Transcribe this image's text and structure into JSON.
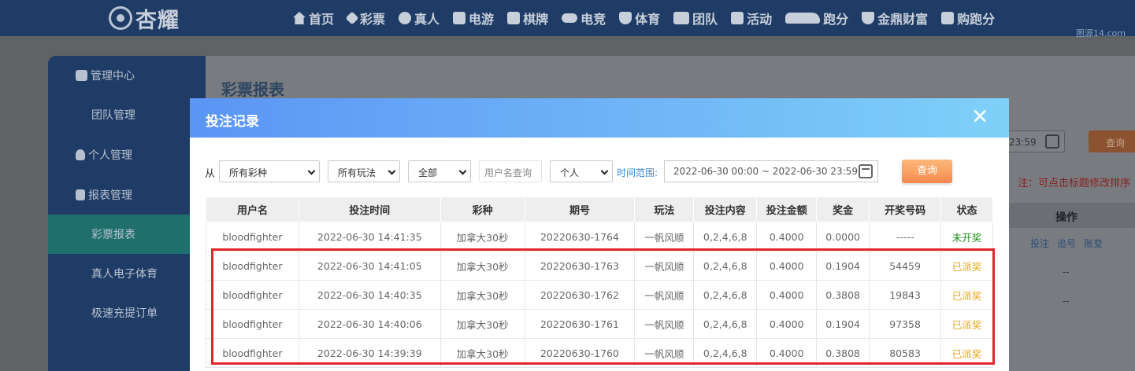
{
  "nav": {
    "logo_text": "杏耀",
    "items": [
      {
        "label": "首页",
        "icon": "home-icon"
      },
      {
        "label": "彩票",
        "icon": "diamond-icon"
      },
      {
        "label": "真人",
        "icon": "person-icon"
      },
      {
        "label": "电游",
        "icon": "game-icon"
      },
      {
        "label": "棋牌",
        "icon": "cards-icon"
      },
      {
        "label": "电竞",
        "icon": "gamepad-icon"
      },
      {
        "label": "体育",
        "icon": "trophy-icon"
      },
      {
        "label": "团队",
        "icon": "team-icon"
      },
      {
        "label": "活动",
        "icon": "gift-icon"
      },
      {
        "label": "跑分",
        "icon": "car-icon"
      },
      {
        "label": "金鼎财富",
        "icon": "money-icon"
      },
      {
        "label": "购跑分",
        "icon": "hi-icon"
      }
    ],
    "watermark": "图源14.com"
  },
  "sidebar": {
    "items": [
      {
        "label": "管理中心",
        "type": "group",
        "icon": "users-icon"
      },
      {
        "label": "团队管理",
        "type": "sub"
      },
      {
        "label": "个人管理",
        "type": "group",
        "icon": "user-icon"
      },
      {
        "label": "报表管理",
        "type": "group",
        "icon": "report-icon"
      },
      {
        "label": "彩票报表",
        "type": "sub",
        "active": true
      },
      {
        "label": "真人电子体育",
        "type": "sub"
      },
      {
        "label": "极速充提订单",
        "type": "sub"
      }
    ]
  },
  "background": {
    "page_title": "彩票报表",
    "date_partial": "23:59",
    "query_label": "查询",
    "note": "注：可点击标题修改排序",
    "op_header": "操作",
    "links": [
      "投注",
      "追号",
      "账变"
    ],
    "dash": "--"
  },
  "modal": {
    "title": "投注记录",
    "close_symbol": "✕",
    "filters": {
      "from_label": "从",
      "lottery": "所有彩种",
      "play": "所有玩法",
      "scope": "全部",
      "username_placeholder": "用户名查询",
      "person": "个人",
      "range_label": "时间范围:",
      "range_value": "2022-06-30 00:00 ~ 2022-06-30 23:59",
      "query_label": "查询"
    },
    "headers": [
      "用户名",
      "投注时间",
      "彩种",
      "期号",
      "玩法",
      "投注内容",
      "投注金额",
      "奖金",
      "开奖号码",
      "状态"
    ],
    "rows": [
      {
        "user": "bloodfighter",
        "time": "2022-06-30 14:41:35",
        "lottery": "加拿大30秒",
        "period": "20220630-1764",
        "play": "一帆风顺",
        "content": "0,2,4,6,8",
        "amount": "0.4000",
        "prize": "0.0000",
        "number": "-----",
        "status": "未开奖",
        "status_type": "open"
      },
      {
        "user": "bloodfighter",
        "time": "2022-06-30 14:41:05",
        "lottery": "加拿大30秒",
        "period": "20220630-1763",
        "play": "一帆风顺",
        "content": "0,2,4,6,8",
        "amount": "0.4000",
        "prize": "0.1904",
        "number": "54459",
        "status": "已派奖",
        "status_type": "paid"
      },
      {
        "user": "bloodfighter",
        "time": "2022-06-30 14:40:35",
        "lottery": "加拿大30秒",
        "period": "20220630-1762",
        "play": "一帆风顺",
        "content": "0,2,4,6,8",
        "amount": "0.4000",
        "prize": "0.3808",
        "number": "19843",
        "status": "已派奖",
        "status_type": "paid"
      },
      {
        "user": "bloodfighter",
        "time": "2022-06-30 14:40:06",
        "lottery": "加拿大30秒",
        "period": "20220630-1761",
        "play": "一帆风顺",
        "content": "0,2,4,6,8",
        "amount": "0.4000",
        "prize": "0.1904",
        "number": "97358",
        "status": "已派奖",
        "status_type": "paid"
      },
      {
        "user": "bloodfighter",
        "time": "2022-06-30 14:39:39",
        "lottery": "加拿大30秒",
        "period": "20220630-1760",
        "play": "一帆风顺",
        "content": "0,2,4,6,8",
        "amount": "0.4000",
        "prize": "0.3808",
        "number": "80583",
        "status": "已派奖",
        "status_type": "paid"
      }
    ]
  },
  "colors": {
    "nav_bg": "#1f3c66",
    "modal_header_start": "#5b95f5",
    "modal_header_end": "#7fd0f8",
    "status_open": "#1d8a1d",
    "status_paid": "#e8a317",
    "highlight": "#e3262b",
    "query_button": "#f5894e"
  }
}
